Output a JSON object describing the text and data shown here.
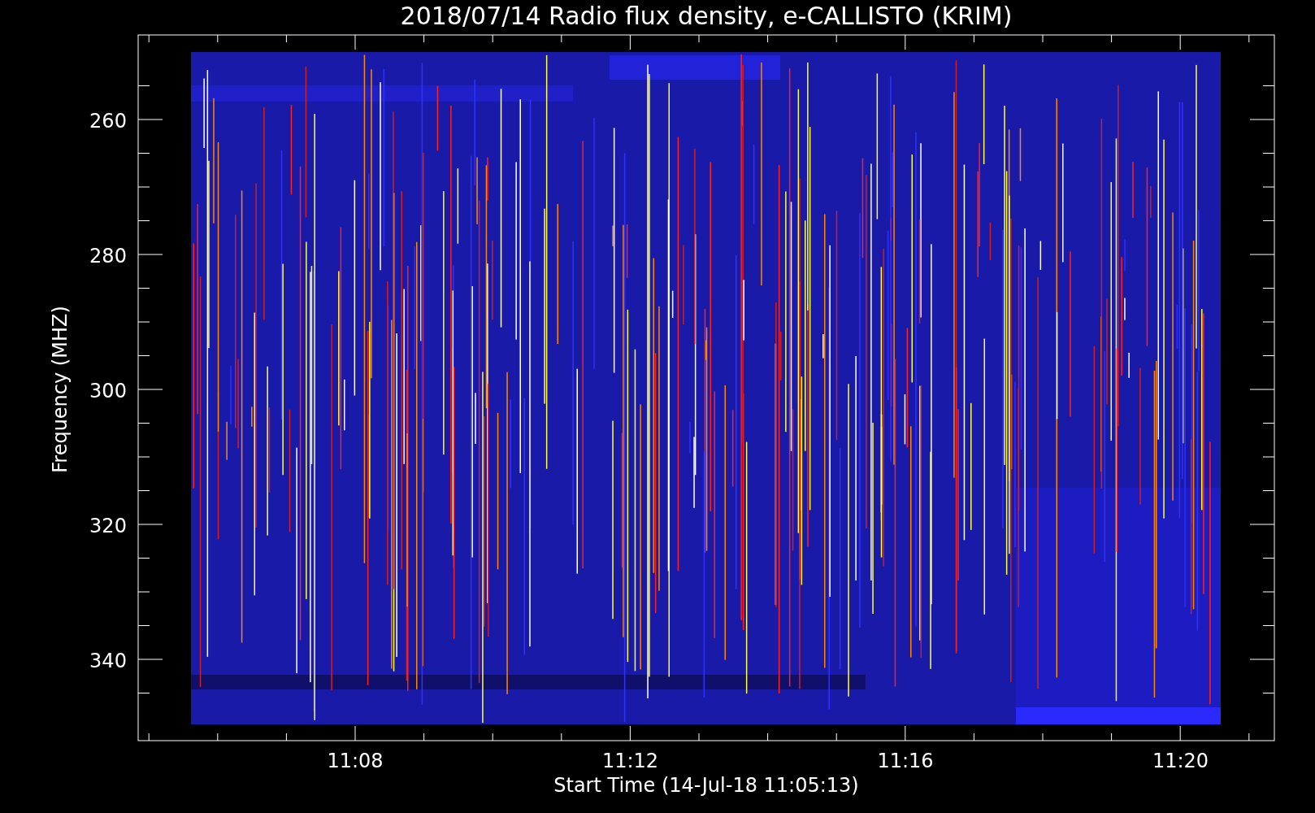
{
  "title": "2018/07/14  Radio flux density, e-CALLISTO (KRIM)",
  "ylabel": "Frequency (MHZ)",
  "xlabel": "Start Time (14-Jul-18 11:05:13)",
  "yticks": [
    "260",
    "280",
    "300",
    "320",
    "340"
  ],
  "xticks": [
    "11:08",
    "11:12",
    "11:16",
    "11:20"
  ]
}
